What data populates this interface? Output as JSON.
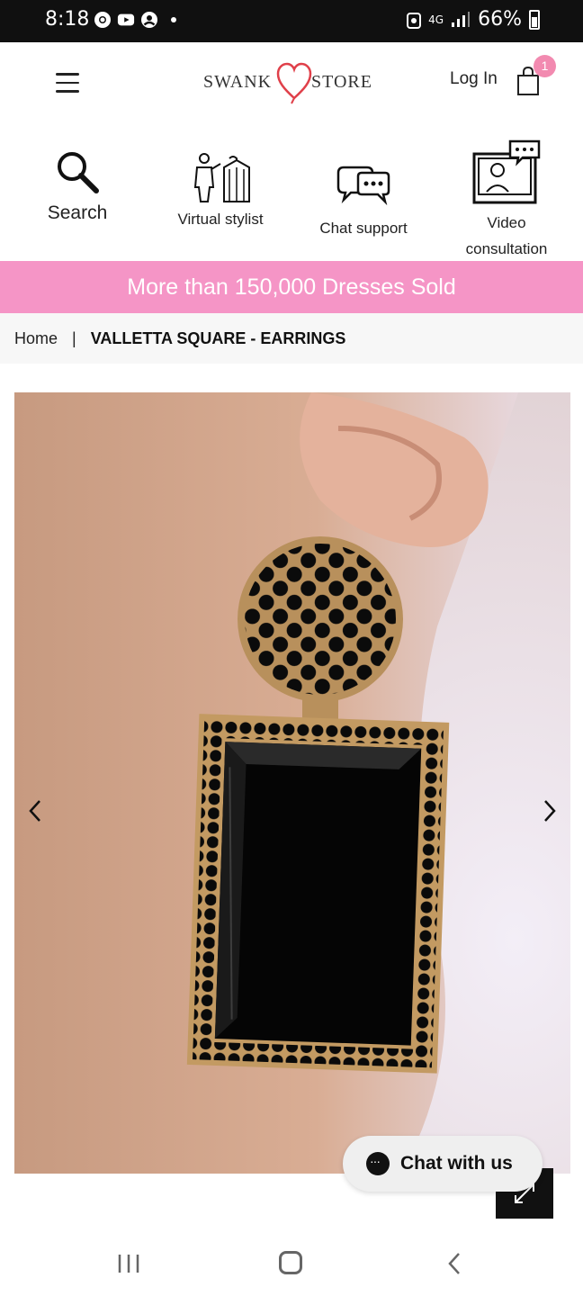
{
  "status_bar": {
    "time": "8:18",
    "network": "4G",
    "battery": "66%",
    "icons": [
      "chrome-icon",
      "youtube-icon",
      "account-icon",
      "notification-dot",
      "data-saver-icon",
      "signal-icon",
      "battery-icon"
    ]
  },
  "header": {
    "logo_left": "SWANK",
    "logo_right": "STORE",
    "login_label": "Log In",
    "cart_count": "1",
    "brand_color": "#e0404a"
  },
  "quick_actions": [
    {
      "label": "Search",
      "icon": "search-icon"
    },
    {
      "label": "Virtual stylist",
      "icon": "stylist-icon"
    },
    {
      "label": "Chat support",
      "icon": "chat-support-icon"
    },
    {
      "label_line1": "Video",
      "label_line2": "consultation",
      "icon": "video-consultation-icon"
    }
  ],
  "promo": {
    "text": "More than 150,000 Dresses Sold",
    "color": "#f595c6"
  },
  "breadcrumb": {
    "home": "Home",
    "separator": "|",
    "current": "VALLETTA SQUARE - EARRINGS"
  },
  "product": {
    "image_subject": "black rhinestone square earring on ear"
  },
  "chat_widget": {
    "label": "Chat with us"
  }
}
